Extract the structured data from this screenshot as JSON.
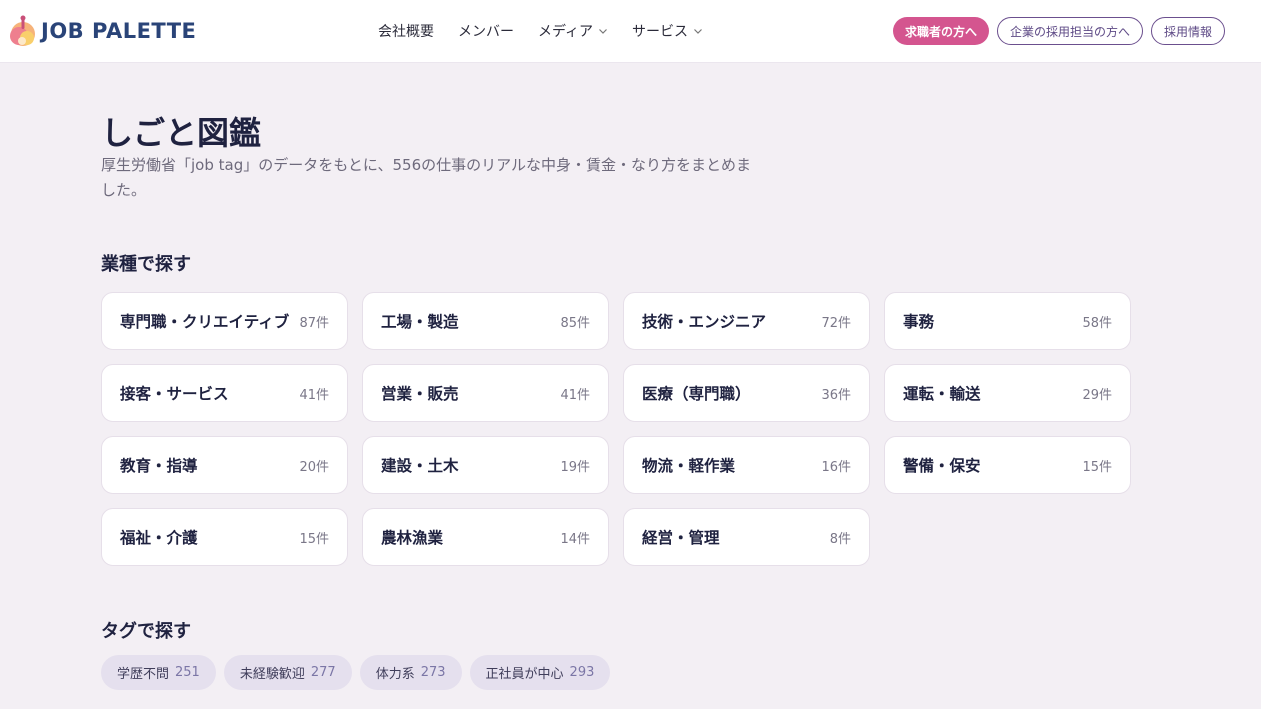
{
  "brand": {
    "name": "JOB PALETTE"
  },
  "nav": {
    "items": [
      {
        "label": "会社概要",
        "dropdown": false
      },
      {
        "label": "メンバー",
        "dropdown": false
      },
      {
        "label": "メディア",
        "dropdown": true
      },
      {
        "label": "サービス",
        "dropdown": true
      }
    ]
  },
  "header_buttons": {
    "job_seeker": "求職者の方へ",
    "corporate": "企業の採用担当の方へ",
    "recruit": "採用情報"
  },
  "page": {
    "title": "しごと図鑑",
    "description": "厚生労働省「job tag」のデータをもとに、556の仕事のリアルな中身・賃金・なり方をまとめました。"
  },
  "industry_section": {
    "heading": "業種で探す",
    "categories": [
      {
        "name": "専門職・クリエイティブ",
        "count": "87件"
      },
      {
        "name": "工場・製造",
        "count": "85件"
      },
      {
        "name": "技術・エンジニア",
        "count": "72件"
      },
      {
        "name": "事務",
        "count": "58件"
      },
      {
        "name": "接客・サービス",
        "count": "41件"
      },
      {
        "name": "営業・販売",
        "count": "41件"
      },
      {
        "name": "医療（専門職）",
        "count": "36件"
      },
      {
        "name": "運転・輸送",
        "count": "29件"
      },
      {
        "name": "教育・指導",
        "count": "20件"
      },
      {
        "name": "建設・土木",
        "count": "19件"
      },
      {
        "name": "物流・軽作業",
        "count": "16件"
      },
      {
        "name": "警備・保安",
        "count": "15件"
      },
      {
        "name": "福祉・介護",
        "count": "15件"
      },
      {
        "name": "農林漁業",
        "count": "14件"
      },
      {
        "name": "経営・管理",
        "count": "8件"
      }
    ]
  },
  "tag_section": {
    "heading": "タグで探す",
    "tags": [
      {
        "label": "学歴不問",
        "count": "251"
      },
      {
        "label": "未経験歓迎",
        "count": "277"
      },
      {
        "label": "体力系",
        "count": "273"
      },
      {
        "label": "正社員が中心",
        "count": "293"
      }
    ]
  },
  "colors": {
    "background": "#f3eff4",
    "accent_pink": "#d4558f",
    "accent_purple": "#6b4f8e",
    "brand_navy": "#2a4478",
    "tag_bg": "#e5e0ee"
  }
}
